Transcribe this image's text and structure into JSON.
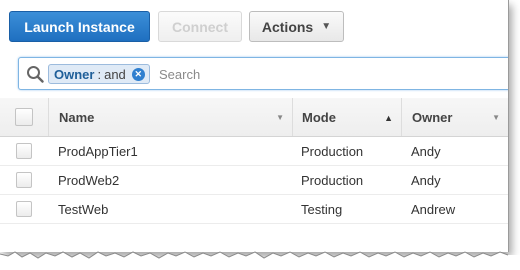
{
  "toolbar": {
    "launch_label": "Launch Instance",
    "connect_label": "Connect",
    "actions_label": "Actions"
  },
  "search": {
    "token_key": "Owner",
    "token_sep": ":",
    "token_value": "and",
    "placeholder": "Search"
  },
  "table": {
    "columns": [
      "Name",
      "Mode",
      "Owner"
    ],
    "rows": [
      [
        "ProdAppTier1",
        "Production",
        "Andy"
      ],
      [
        "ProdWeb2",
        "Production",
        "Andy"
      ],
      [
        "TestWeb",
        "Testing",
        "Andrew"
      ]
    ]
  },
  "colors": {
    "primary": "#1f6fc0",
    "token_bg": "#dfeaf6",
    "token_close": "#2f7fcf"
  }
}
